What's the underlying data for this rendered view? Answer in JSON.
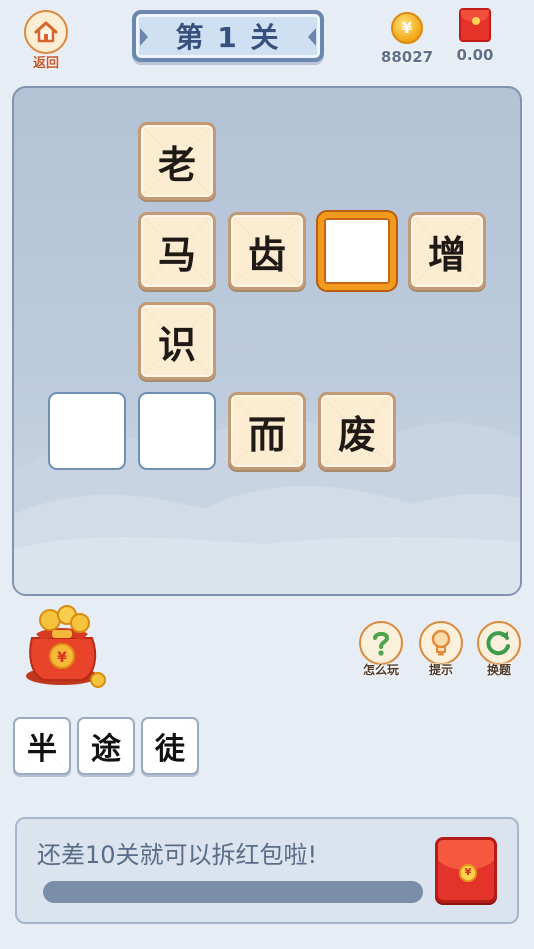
{
  "header": {
    "back_label": "返回",
    "level_title": "第 1 关",
    "coins": "88027",
    "coin_symbol": "¥",
    "redpack_amount": "0.00"
  },
  "board": {
    "grid_chars": {
      "r0c1": "老",
      "r1c1": "马",
      "r1c2": "齿",
      "r1c3": "",
      "r1c4": "增",
      "r2c1": "识",
      "r3c0": "",
      "r3c1": "",
      "r3c2": "而",
      "r3c3": "废"
    }
  },
  "helpers": {
    "how_to_play": "怎么玩",
    "hint": "提示",
    "change_puzzle": "换题"
  },
  "candidates": [
    "半",
    "途",
    "徒"
  ],
  "progress": {
    "message": "还差10关就可以拆红包啦!",
    "fraction": 0.0,
    "seal_symbol": "¥"
  },
  "colors": {
    "board_bg": "#b3c3d6",
    "tile_char_bg": "#fcecd1",
    "tile_selected_border": "#f29a1e",
    "accent_orange": "#d98a3d",
    "progress_track": "#7a8da9",
    "red_packet": "#e3332a"
  },
  "icons": [
    "home-icon",
    "coin-icon",
    "red-packet-icon",
    "lucky-bag-icon",
    "question-icon",
    "lightbulb-icon",
    "refresh-icon"
  ]
}
